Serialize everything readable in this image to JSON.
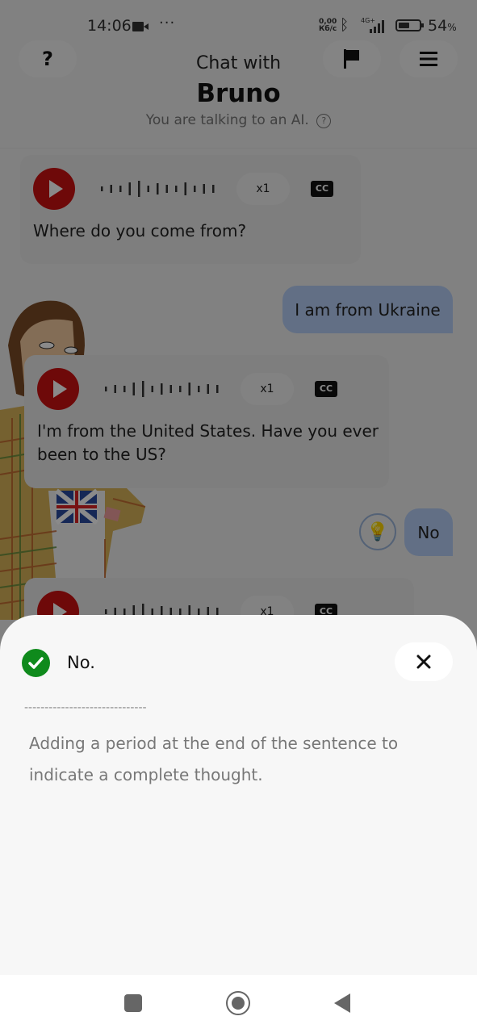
{
  "status_bar": {
    "time": "14:06",
    "more_indicator": "···",
    "net_speed_value": "0,00",
    "net_speed_unit": "Кб/с",
    "network_type": "4G+",
    "battery_percent": 54,
    "battery_label": "54",
    "battery_suffix": "%"
  },
  "header": {
    "help_icon": "?",
    "title_prefix": "Chat with",
    "partner_name": "Bruno",
    "subtitle": "You are talking to an AI.",
    "subtitle_help": "?"
  },
  "messages": [
    {
      "sender": "bot",
      "text": "Where do you come from?",
      "speed": "x1",
      "cc": "CC"
    },
    {
      "sender": "user",
      "text": "I am from Ukraine"
    },
    {
      "sender": "bot",
      "text": "I'm from the United States. Have you ever been to the US?",
      "speed": "x1",
      "cc": "CC"
    },
    {
      "sender": "user",
      "text": "No",
      "hint_icon": "💡"
    },
    {
      "sender": "bot",
      "text": "",
      "speed": "x1",
      "cc": "CC"
    }
  ],
  "feedback_sheet": {
    "corrected_text": "No.",
    "separator": "------------------------------",
    "explanation": "Adding a period at the end of the sentence to indicate a complete thought.",
    "close_label": "✕"
  },
  "colors": {
    "play_button": "#cc1111",
    "user_bubble": "#b6cef5",
    "success_check": "#0f8a1c"
  }
}
